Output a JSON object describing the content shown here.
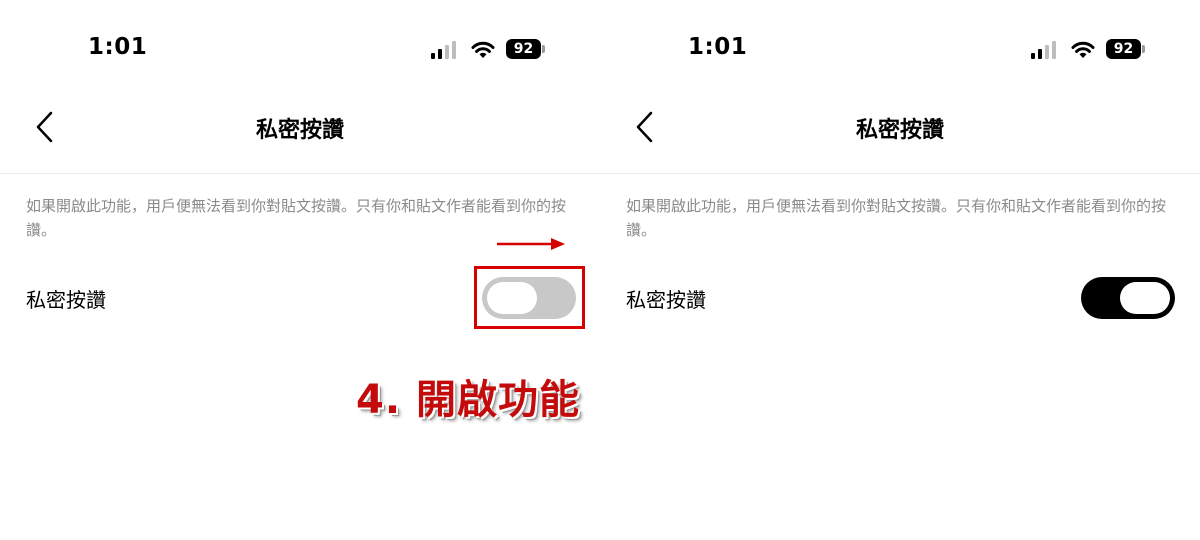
{
  "screens": [
    {
      "status_time": "1:01",
      "battery": "92",
      "title": "私密按讚",
      "description": "如果開啟此功能，用戶便無法看到你對貼文按讚。只有你和貼文作者能看到你的按讚。",
      "setting_label": "私密按讚",
      "toggle_state": "off"
    },
    {
      "status_time": "1:01",
      "battery": "92",
      "title": "私密按讚",
      "description": "如果開啟此功能，用戶便無法看到你對貼文按讚。只有你和貼文作者能看到你的按讚。",
      "setting_label": "私密按讚",
      "toggle_state": "on"
    }
  ],
  "annotation": {
    "text": "4. 開啟功能",
    "color": "#c40a0a"
  },
  "icons": [
    "signal-icon",
    "wifi-icon",
    "battery-icon",
    "back-chevron-icon",
    "arrow-right-icon"
  ]
}
